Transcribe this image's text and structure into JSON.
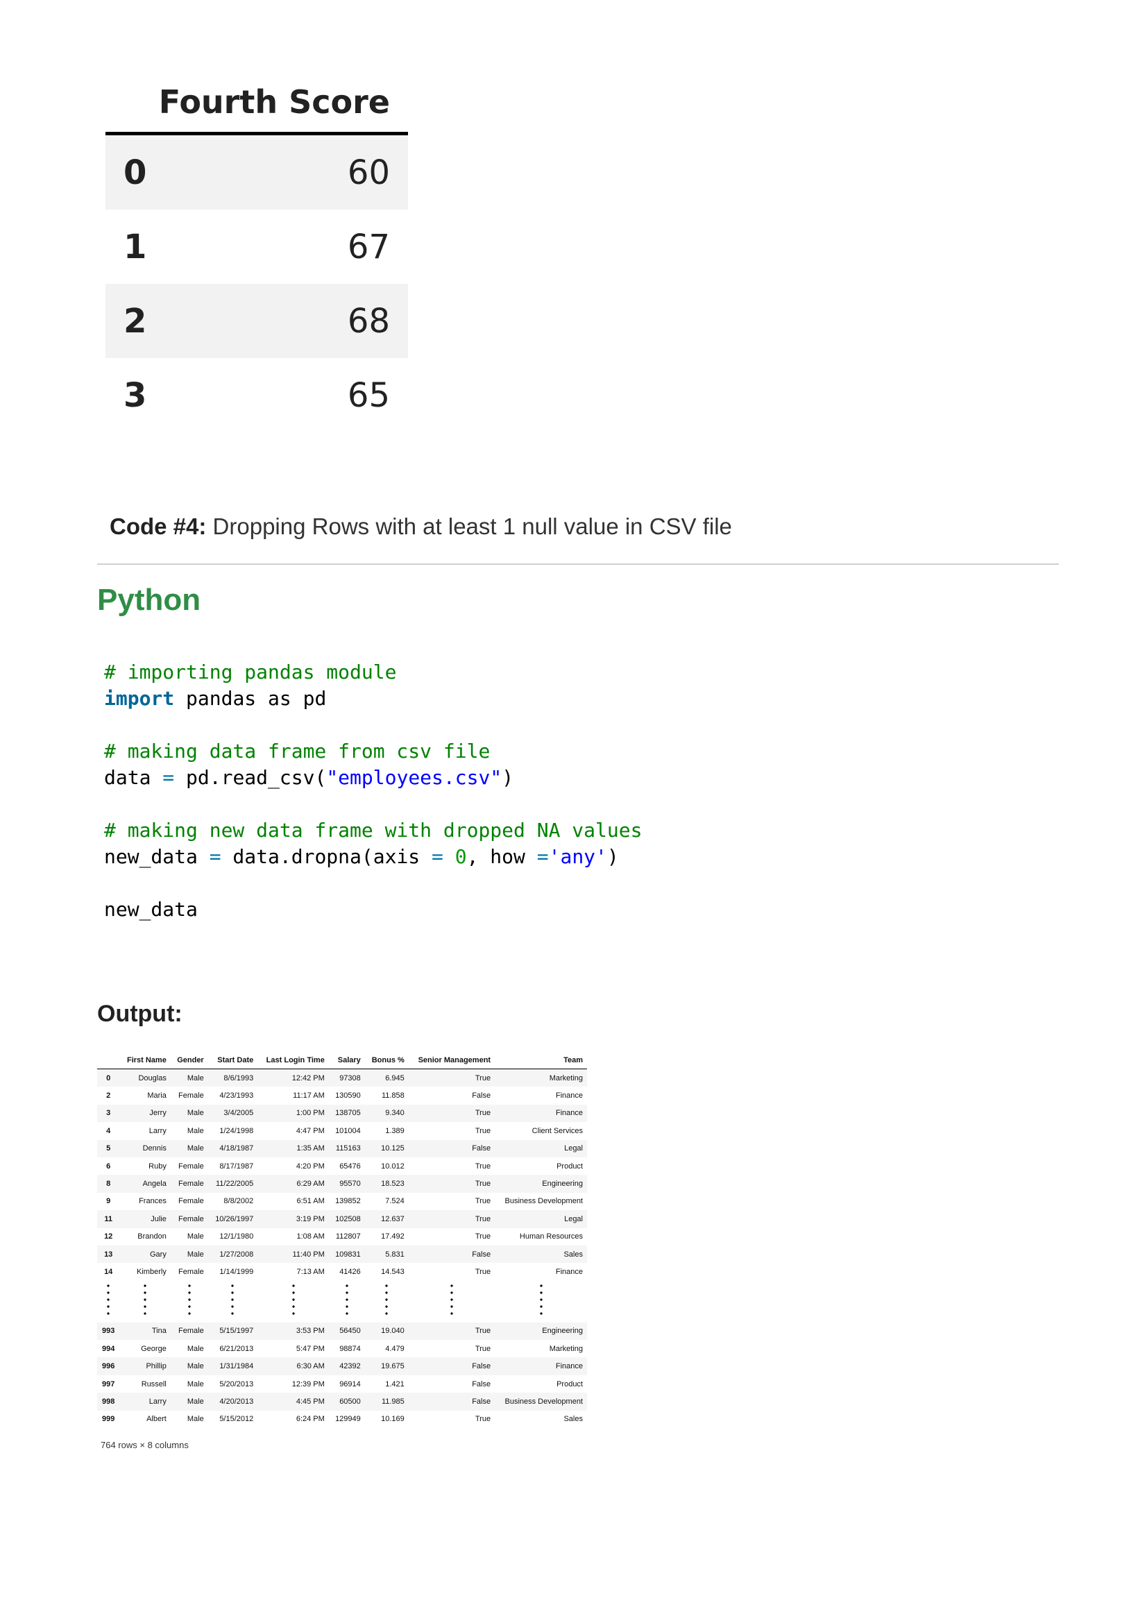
{
  "score_table": {
    "header": "Fourth Score",
    "rows": [
      {
        "index": "0",
        "value": "60"
      },
      {
        "index": "1",
        "value": "67"
      },
      {
        "index": "2",
        "value": "68"
      },
      {
        "index": "3",
        "value": "65"
      }
    ]
  },
  "caption": {
    "label": "Code #4:",
    "text": " Dropping Rows with at least 1 null value in CSV file"
  },
  "language": "Python",
  "code_lines": [
    [
      {
        "t": "# importing pandas module",
        "c": "comment"
      }
    ],
    [
      {
        "t": "import",
        "c": "kw"
      },
      {
        "t": " pandas as pd",
        "c": ""
      }
    ],
    [],
    [
      {
        "t": "# making data frame from csv file",
        "c": "comment"
      }
    ],
    [
      {
        "t": "data ",
        "c": ""
      },
      {
        "t": "=",
        "c": "op"
      },
      {
        "t": " pd.read_csv(",
        "c": ""
      },
      {
        "t": "\"employees.csv\"",
        "c": "str"
      },
      {
        "t": ")",
        "c": ""
      }
    ],
    [],
    [
      {
        "t": "# making new data frame with dropped NA values",
        "c": "comment"
      }
    ],
    [
      {
        "t": "new_data ",
        "c": ""
      },
      {
        "t": "=",
        "c": "op"
      },
      {
        "t": " data.dropna(axis ",
        "c": ""
      },
      {
        "t": "=",
        "c": "op"
      },
      {
        "t": " ",
        "c": ""
      },
      {
        "t": "0",
        "c": "num"
      },
      {
        "t": ", how ",
        "c": ""
      },
      {
        "t": "=",
        "c": "op"
      },
      {
        "t": "'any'",
        "c": "str"
      },
      {
        "t": ")",
        "c": ""
      }
    ],
    [],
    [
      {
        "t": "new_data",
        "c": ""
      }
    ]
  ],
  "output_label": "Output:",
  "dataframe": {
    "columns": [
      "",
      "First Name",
      "Gender",
      "Start Date",
      "Last Login Time",
      "Salary",
      "Bonus %",
      "Senior Management",
      "Team"
    ],
    "rows_top": [
      [
        "0",
        "Douglas",
        "Male",
        "8/6/1993",
        "12:42 PM",
        "97308",
        "6.945",
        "True",
        "Marketing"
      ],
      [
        "2",
        "Maria",
        "Female",
        "4/23/1993",
        "11:17 AM",
        "130590",
        "11.858",
        "False",
        "Finance"
      ],
      [
        "3",
        "Jerry",
        "Male",
        "3/4/2005",
        "1:00 PM",
        "138705",
        "9.340",
        "True",
        "Finance"
      ],
      [
        "4",
        "Larry",
        "Male",
        "1/24/1998",
        "4:47 PM",
        "101004",
        "1.389",
        "True",
        "Client Services"
      ],
      [
        "5",
        "Dennis",
        "Male",
        "4/18/1987",
        "1:35 AM",
        "115163",
        "10.125",
        "False",
        "Legal"
      ],
      [
        "6",
        "Ruby",
        "Female",
        "8/17/1987",
        "4:20 PM",
        "65476",
        "10.012",
        "True",
        "Product"
      ],
      [
        "8",
        "Angela",
        "Female",
        "11/22/2005",
        "6:29 AM",
        "95570",
        "18.523",
        "True",
        "Engineering"
      ],
      [
        "9",
        "Frances",
        "Female",
        "8/8/2002",
        "6:51 AM",
        "139852",
        "7.524",
        "True",
        "Business Development"
      ],
      [
        "11",
        "Julie",
        "Female",
        "10/26/1997",
        "3:19 PM",
        "102508",
        "12.637",
        "True",
        "Legal"
      ],
      [
        "12",
        "Brandon",
        "Male",
        "12/1/1980",
        "1:08 AM",
        "112807",
        "17.492",
        "True",
        "Human Resources"
      ],
      [
        "13",
        "Gary",
        "Male",
        "1/27/2008",
        "11:40 PM",
        "109831",
        "5.831",
        "False",
        "Sales"
      ],
      [
        "14",
        "Kimberly",
        "Female",
        "1/14/1999",
        "7:13 AM",
        "41426",
        "14.543",
        "True",
        "Finance"
      ]
    ],
    "rows_bottom": [
      [
        "993",
        "Tina",
        "Female",
        "5/15/1997",
        "3:53 PM",
        "56450",
        "19.040",
        "True",
        "Engineering"
      ],
      [
        "994",
        "George",
        "Male",
        "6/21/2013",
        "5:47 PM",
        "98874",
        "4.479",
        "True",
        "Marketing"
      ],
      [
        "996",
        "Phillip",
        "Male",
        "1/31/1984",
        "6:30 AM",
        "42392",
        "19.675",
        "False",
        "Finance"
      ],
      [
        "997",
        "Russell",
        "Male",
        "5/20/2013",
        "12:39 PM",
        "96914",
        "1.421",
        "False",
        "Product"
      ],
      [
        "998",
        "Larry",
        "Male",
        "4/20/2013",
        "4:45 PM",
        "60500",
        "11.985",
        "False",
        "Business Development"
      ],
      [
        "999",
        "Albert",
        "Male",
        "5/15/2012",
        "6:24 PM",
        "129949",
        "10.169",
        "True",
        "Sales"
      ]
    ],
    "footer": "764 rows × 8 columns"
  }
}
